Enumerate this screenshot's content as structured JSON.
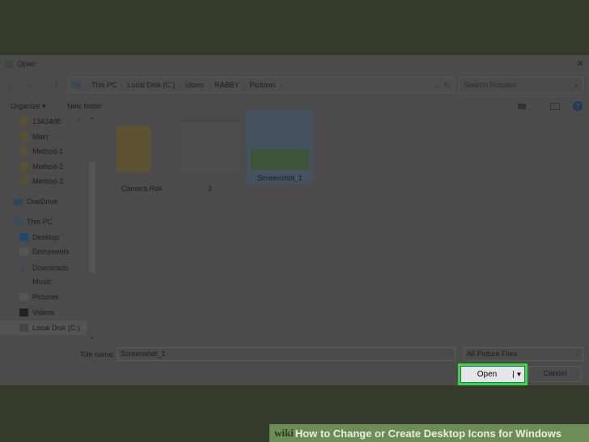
{
  "dialog": {
    "title": "Open",
    "close": "✕"
  },
  "nav": {
    "back": "←",
    "forward": "→",
    "recent": "⌄",
    "up": "↑",
    "path": [
      "This PC",
      "Local Disk (C:)",
      "Users",
      "RABBY",
      "Pictures"
    ],
    "refresh": "↻",
    "dropdown": "⌄",
    "search_placeholder": "Search Pictures",
    "search_icon": "⌕"
  },
  "toolbar": {
    "organize": "Organize ▾",
    "new_folder": "New folder",
    "help": "?"
  },
  "sidebar": {
    "quick": [
      "1343408",
      "Main",
      "Method-1",
      "Method-2",
      "Method-3"
    ],
    "onedrive": "OneDrive",
    "thispc": "This PC",
    "pc_items": [
      "Desktop",
      "Documents",
      "Downloads",
      "Music",
      "Pictures",
      "Videos",
      "Local Disk (C:)"
    ]
  },
  "files": [
    {
      "name": "Camera Roll",
      "type": "folder"
    },
    {
      "name": "3",
      "type": "image"
    },
    {
      "name": "Screenshot_1",
      "type": "image",
      "selected": true
    }
  ],
  "bottom": {
    "file_name_label": "File name:",
    "file_name": "Screenshot_1",
    "file_type": "All Picture Files",
    "open": "Open",
    "cancel": "Cancel"
  },
  "footer": {
    "brand": "wiki",
    "text": "How to Change or Create Desktop Icons for Windows"
  },
  "colors": {
    "highlight": "#3cdc2c",
    "background": "#343a2c",
    "banner": "#6d8d56"
  }
}
